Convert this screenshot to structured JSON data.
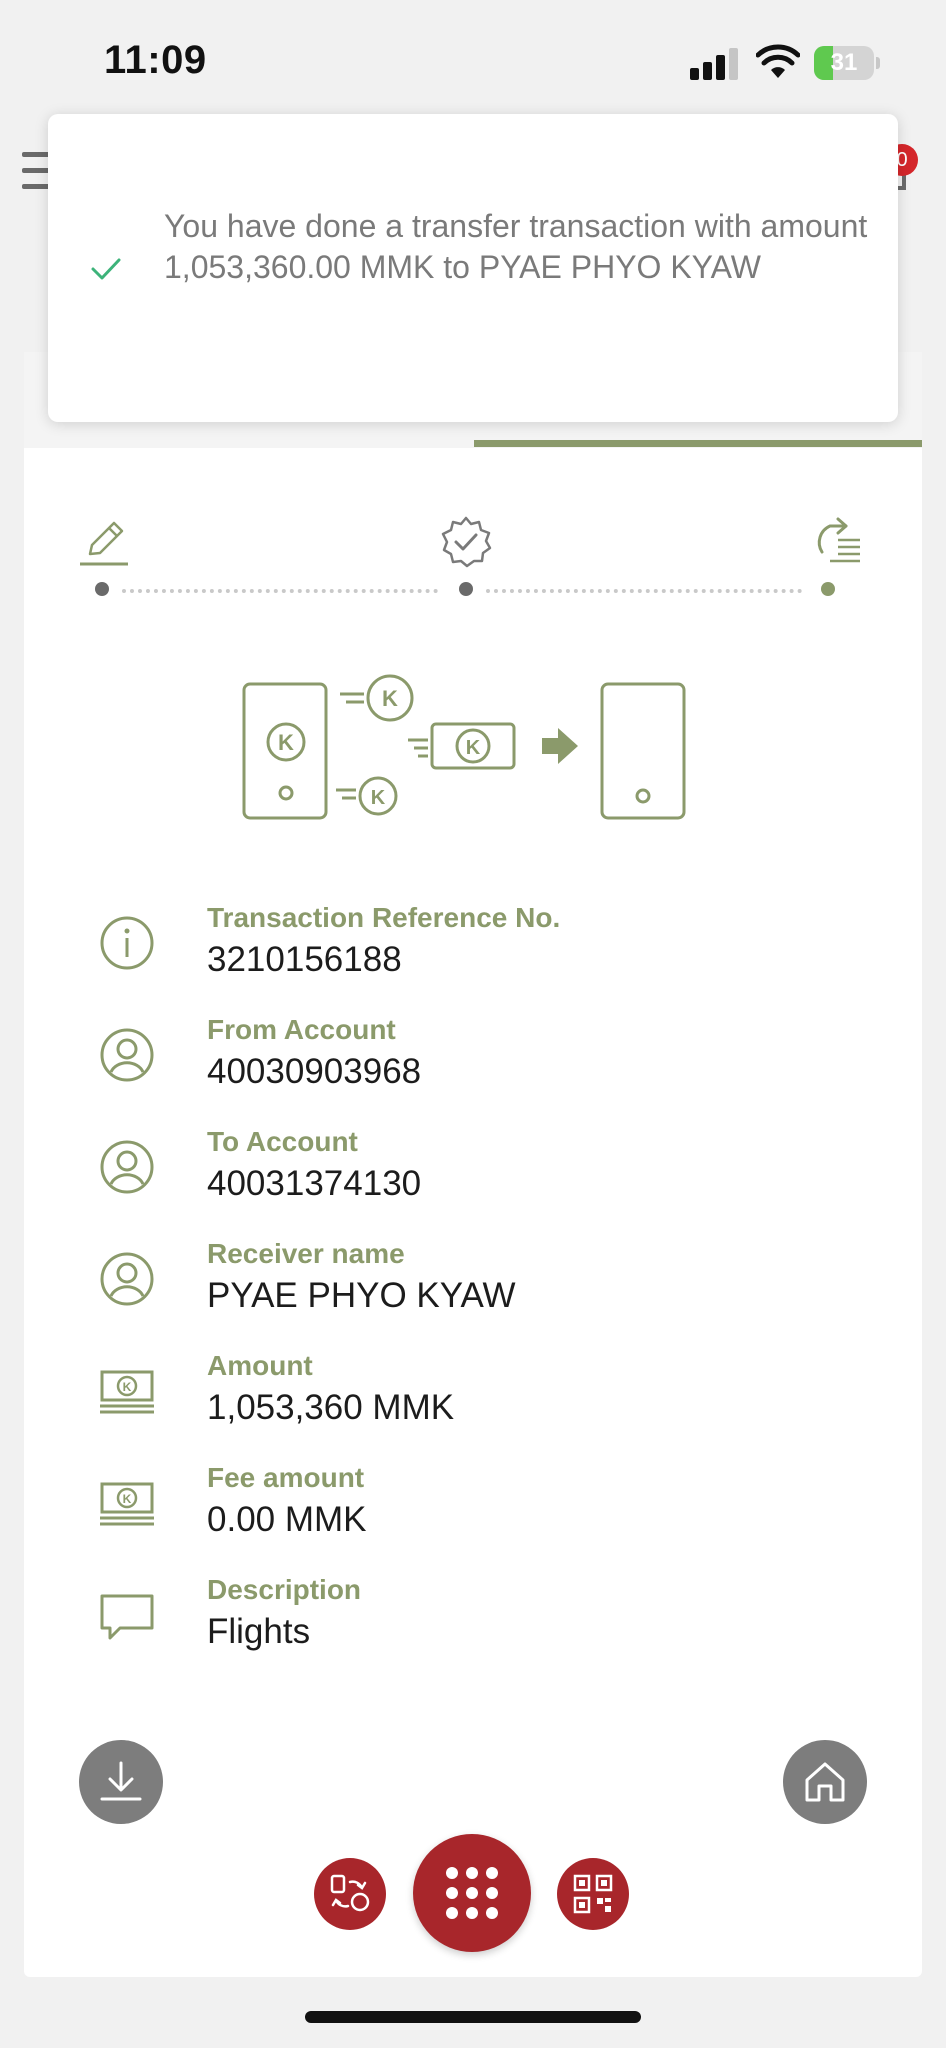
{
  "status_bar": {
    "time": "11:09",
    "battery_level": 31,
    "battery_label": "31"
  },
  "header": {
    "notification_count": "0"
  },
  "toast": {
    "message": "You have done a transfer transaction with amount 1,053,360.00 MMK to PYAE PHYO KYAW",
    "icon": "check-icon"
  },
  "stepper": {
    "steps": [
      {
        "icon": "pencil-icon",
        "status": "done"
      },
      {
        "icon": "verified-badge-icon",
        "status": "done"
      },
      {
        "icon": "share-list-icon",
        "status": "current"
      }
    ]
  },
  "details": {
    "rows": [
      {
        "icon": "info-icon",
        "label": "Transaction Reference No.",
        "value": "3210156188"
      },
      {
        "icon": "user-icon",
        "label": "From Account",
        "value": "40030903968"
      },
      {
        "icon": "user-icon",
        "label": "To Account",
        "value": "40031374130"
      },
      {
        "icon": "user-icon",
        "label": "Receiver name",
        "value": "PYAE PHYO KYAW"
      },
      {
        "icon": "money-icon",
        "label": "Amount",
        "value": "1,053,360 MMK"
      },
      {
        "icon": "money-icon",
        "label": "Fee amount",
        "value": "0.00 MMK"
      },
      {
        "icon": "comment-icon",
        "label": "Description",
        "value": "Flights"
      }
    ]
  },
  "colors": {
    "accent": "#8b9a6b",
    "brand_red": "#a8262b",
    "grey_button": "#7d7d7d",
    "notification_badge": "#d4262a",
    "battery_fill": "#5fc94f",
    "toast_check": "#3db37a"
  },
  "bottom_actions": {
    "download": "download-icon",
    "home": "home-icon",
    "transfer": "transfer-icon",
    "menu": "grid-menu-icon",
    "qr": "qr-code-icon"
  }
}
